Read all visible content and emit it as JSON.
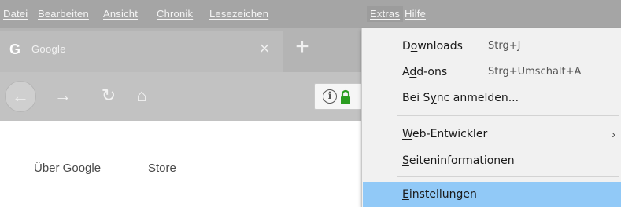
{
  "menubar": {
    "items": [
      "Datei",
      "Bearbeiten",
      "Ansicht",
      "Chronik",
      "Lesezeichen",
      "Extras",
      "Hilfe"
    ],
    "active": "Extras"
  },
  "tab": {
    "favicon": "google-g-icon",
    "title": "Google",
    "close": "×",
    "new_tab": "+"
  },
  "nav": {
    "back": "←",
    "forward": "→",
    "reload": "↻",
    "home": "⌂",
    "info": "i"
  },
  "page": {
    "links": [
      "Über Google",
      "Store"
    ]
  },
  "dropdown": {
    "items": [
      {
        "pre": "D",
        "mn": "o",
        "post": "wnloads",
        "shortcut": "Strg+J"
      },
      {
        "pre": "A",
        "mn": "d",
        "post": "d-ons",
        "shortcut": "Strg+Umschalt+A"
      },
      {
        "pre": "Bei S",
        "mn": "y",
        "post": "nc anmelden...",
        "shortcut": ""
      },
      {
        "pre": "",
        "mn": "W",
        "post": "eb-Entwickler",
        "shortcut": "",
        "submenu": "›"
      },
      {
        "pre": "",
        "mn": "S",
        "post": "eiteninformationen",
        "shortcut": ""
      },
      {
        "pre": "",
        "mn": "E",
        "post": "instellungen",
        "shortcut": "",
        "highlighted": true
      }
    ]
  },
  "colors": {
    "menubar_bg": "#a5a5a5",
    "highlight": "#91c9f7",
    "lock_green": "#2a9d20"
  }
}
